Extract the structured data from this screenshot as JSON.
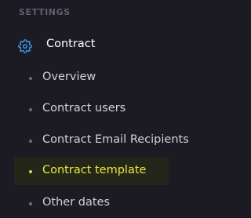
{
  "section": {
    "title": "SETTINGS"
  },
  "group": {
    "label": "Contract",
    "icon": "gear-icon",
    "icon_color": "#3aa6e8"
  },
  "items": [
    {
      "label": "Overview",
      "active": false
    },
    {
      "label": "Contract users",
      "active": false
    },
    {
      "label": "Contract Email Recipients",
      "active": false
    },
    {
      "label": "Contract template",
      "active": true
    },
    {
      "label": "Other dates",
      "active": false
    }
  ],
  "colors": {
    "background": "#1c1b24",
    "active_text": "#e8ea3a",
    "active_bg": "#25261a"
  }
}
